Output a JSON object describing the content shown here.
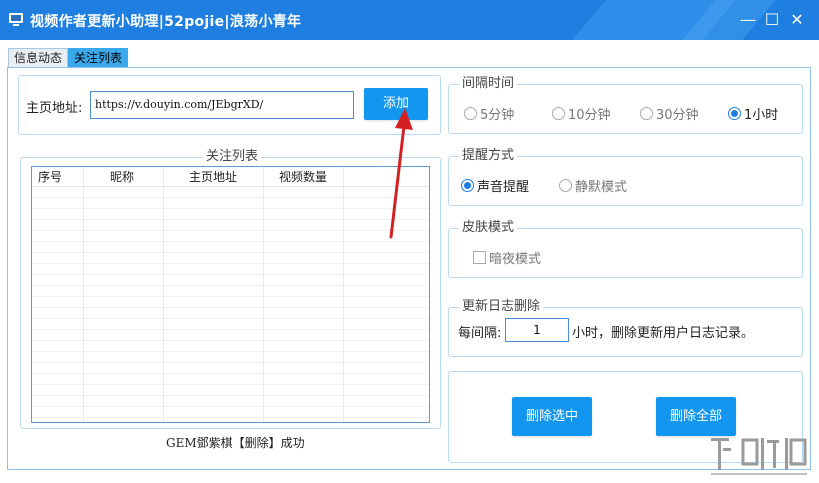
{
  "window": {
    "title": "视频作者更新小助理|52pojie|浪荡小青年",
    "controls": {
      "minimize": "—",
      "maximize": "☐",
      "close": "✕"
    }
  },
  "tabs": [
    {
      "label": "信息动态",
      "active": false
    },
    {
      "label": "关注列表",
      "active": true
    }
  ],
  "homepage": {
    "label": "主页地址:",
    "value": "https://v.douyin.com/JEbgrXD/",
    "add_button": "添加"
  },
  "follow_list": {
    "legend": "关注列表",
    "columns": [
      "序号",
      "昵称",
      "主页地址",
      "视频数量"
    ],
    "rows": []
  },
  "status_text": "GEM鄧紫棋【删除】成功",
  "interval": {
    "legend": "间隔时间",
    "options": [
      "5分钟",
      "10分钟",
      "30分钟",
      "1小时"
    ],
    "selected": "1小时"
  },
  "reminder": {
    "legend": "提醒方式",
    "options": [
      "声音提醒",
      "静默模式"
    ],
    "selected": "声音提醒"
  },
  "skin": {
    "legend": "皮肤模式",
    "night_mode_label": "暗夜模式",
    "night_mode_checked": false
  },
  "log_cleanup": {
    "legend": "更新日志删除",
    "prefix": "每间隔:",
    "value": "1",
    "suffix": "小时，删除更新用户日志记录。"
  },
  "actions": {
    "delete_selected": "删除选中",
    "delete_all": "删除全部"
  },
  "colors": {
    "titlebar": "#1e7fe0",
    "button": "#1296f0",
    "accent": "#3aa9ec",
    "arrow": "#d42020"
  },
  "watermark": "下载吧"
}
